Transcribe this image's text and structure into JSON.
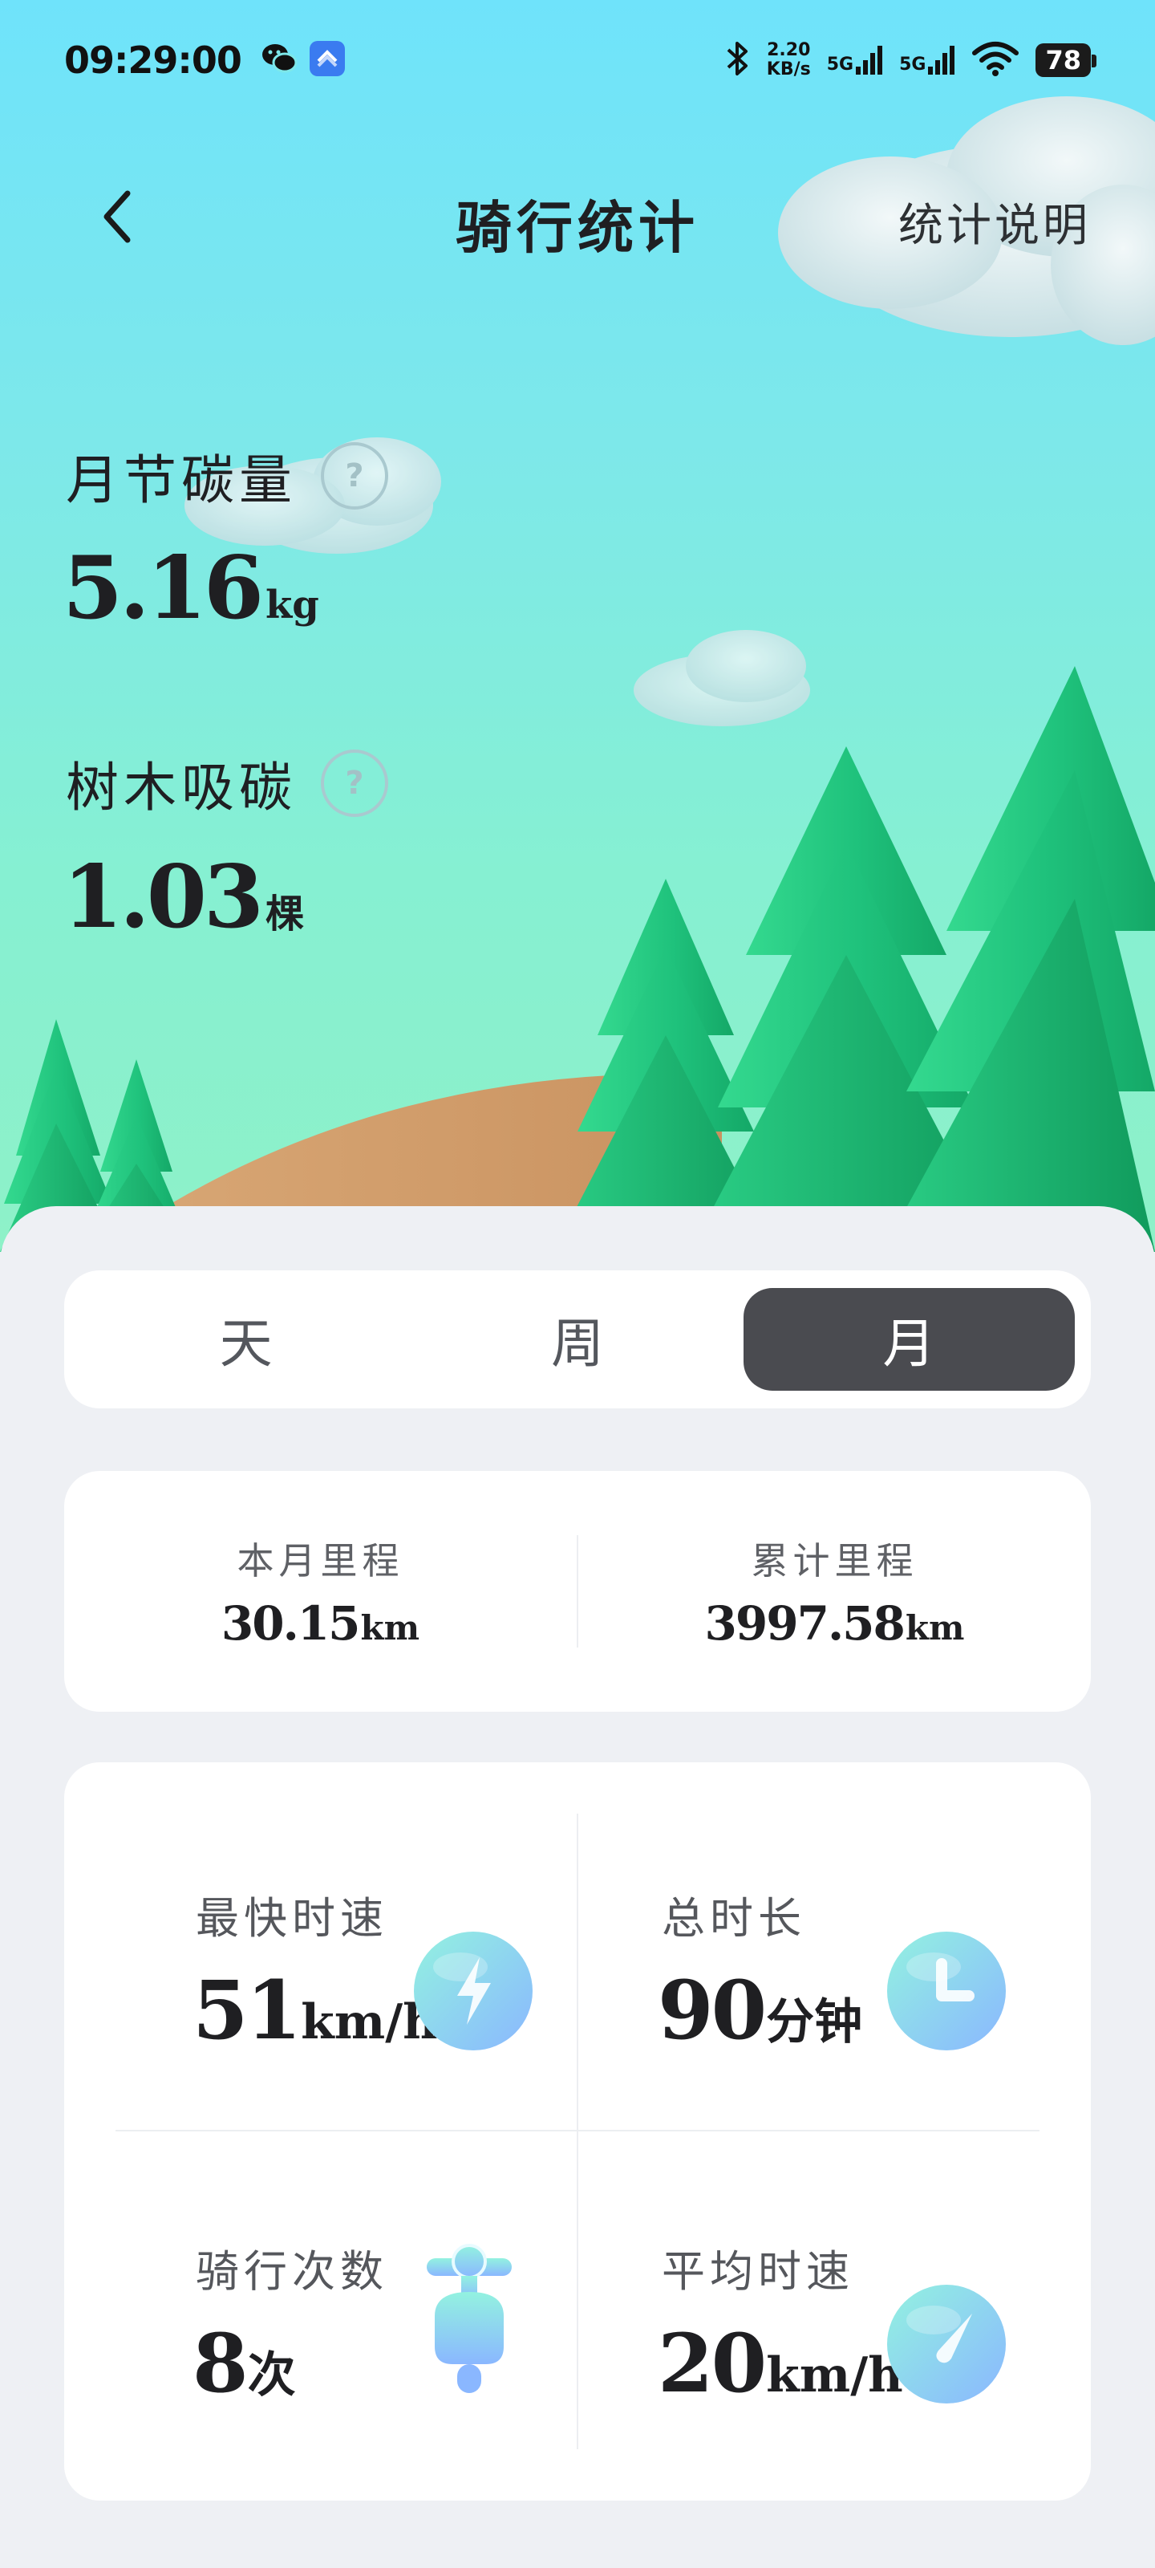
{
  "status_bar": {
    "time": "09:29:00",
    "net_speed_value": "2.20",
    "net_speed_unit": "KB/s",
    "signal_1": "5G",
    "signal_2": "5G",
    "battery": "78"
  },
  "nav": {
    "title": "骑行统计",
    "help_link": "统计说明"
  },
  "carbon": {
    "label": "月节碳量",
    "value": "5.16",
    "unit": "kg"
  },
  "trees": {
    "label": "树木吸碳",
    "value": "1.03",
    "unit": "棵"
  },
  "help_glyph": "?",
  "tabs": [
    {
      "label": "天",
      "active": false
    },
    {
      "label": "周",
      "active": false
    },
    {
      "label": "月",
      "active": true
    }
  ],
  "distance": {
    "month": {
      "label": "本月里程",
      "value": "30.15",
      "unit": "km"
    },
    "total": {
      "label": "累计里程",
      "value": "3997.58",
      "unit": "km"
    }
  },
  "stats": {
    "max_speed": {
      "label": "最快时速",
      "value": "51",
      "unit": "km/h",
      "icon": "lightning-icon"
    },
    "total_time": {
      "label": "总时长",
      "value": "90",
      "unit": "分钟",
      "icon": "clock-icon"
    },
    "ride_count": {
      "label": "骑行次数",
      "value": "8",
      "unit": "次",
      "icon": "scooter-icon"
    },
    "avg_speed": {
      "label": "平均时速",
      "value": "20",
      "unit": "km/h",
      "icon": "speedometer-icon"
    }
  },
  "colors": {
    "sky_top": "#6fe3fb",
    "sky_bottom": "#8ef1c8",
    "tree_green": "#1fc27c",
    "active_tab": "#4a4b50",
    "icon_gradient_start": "#8ff0e6",
    "icon_gradient_end": "#8ab9ff"
  }
}
